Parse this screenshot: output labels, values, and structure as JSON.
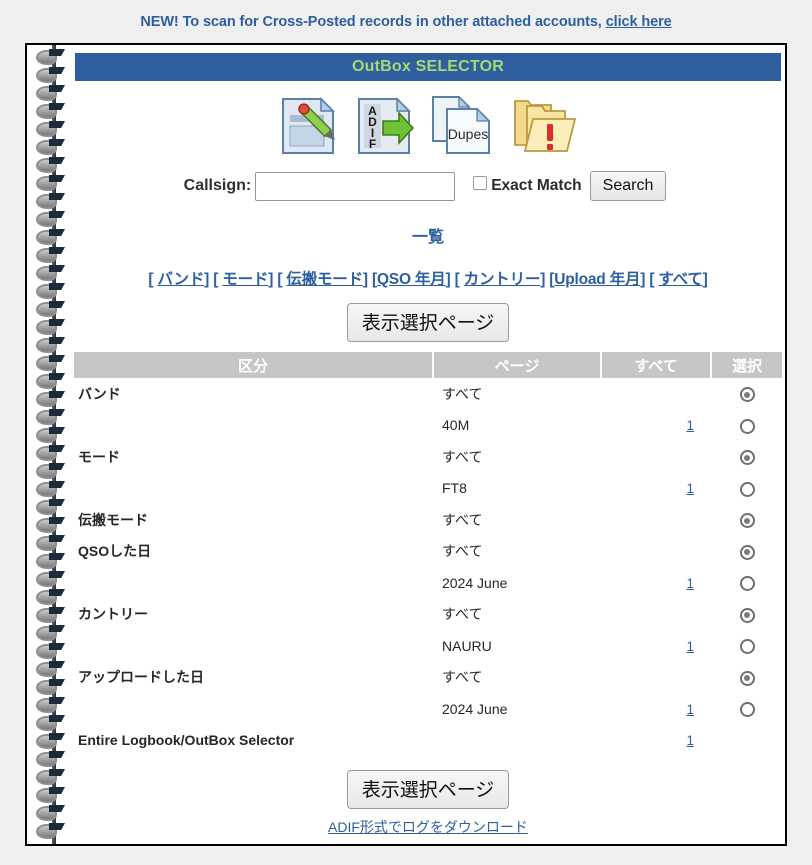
{
  "promo": {
    "text": "NEW! To scan for Cross-Posted records in other attached accounts,",
    "link_label": "click here"
  },
  "titlebar": {
    "title": "OutBox SELECTOR"
  },
  "toolbar": {
    "icons": [
      {
        "name": "edit-document-icon",
        "label": "Edit"
      },
      {
        "name": "adif-export-icon",
        "label": "ADIF"
      },
      {
        "name": "dupes-document-icon",
        "label": "Dupes"
      },
      {
        "name": "folder-alert-icon",
        "label": "Alerts"
      }
    ]
  },
  "search": {
    "callsign_label": "Callsign:",
    "callsign_value": "",
    "callsign_placeholder": "",
    "exact_match_label": "Exact Match",
    "exact_match_checked": false,
    "search_button": "Search"
  },
  "list": {
    "heading": "一覧",
    "nav_links": [
      "バンド",
      "モード",
      "伝搬モード",
      "QSO 年月",
      "カントリー",
      "Upload 年月",
      "すべて"
    ],
    "display_button": "表示選択ページ"
  },
  "table": {
    "headers": [
      "区分",
      "ページ",
      "すべて",
      "選択"
    ],
    "rows": [
      {
        "kubun": "バンド",
        "page": "すべて",
        "all": "",
        "radio": "on"
      },
      {
        "kubun": "",
        "page": "40M",
        "all": "1",
        "radio": "off"
      },
      {
        "kubun": "モード",
        "page": "すべて",
        "all": "",
        "radio": "on"
      },
      {
        "kubun": "",
        "page": "FT8",
        "all": "1",
        "radio": "off"
      },
      {
        "kubun": "伝搬モード",
        "page": "すべて",
        "all": "",
        "radio": "on"
      },
      {
        "kubun": "QSOした日",
        "page": "すべて",
        "all": "",
        "radio": "on"
      },
      {
        "kubun": "",
        "page": "2024 June",
        "all": "1",
        "radio": "off"
      },
      {
        "kubun": "カントリー",
        "page": "すべて",
        "all": "",
        "radio": "on"
      },
      {
        "kubun": "",
        "page": "NAURU",
        "all": "1",
        "radio": "off"
      },
      {
        "kubun": "アップロードした日",
        "page": "すべて",
        "all": "",
        "radio": "on"
      },
      {
        "kubun": "",
        "page": "2024 June",
        "all": "1",
        "radio": "off"
      },
      {
        "kubun": "Entire Logbook/OutBox Selector",
        "page": "",
        "all": "1",
        "radio": "none"
      }
    ]
  },
  "footer": {
    "display_button": "表示選択ページ",
    "download_link": "ADIF形式でログをダウンロード"
  },
  "colors": {
    "accent_blue": "#2d5f9e",
    "title_text_green": "#a5d877",
    "table_header_gray": "#c6c6c6",
    "page_background": "#efefef"
  }
}
